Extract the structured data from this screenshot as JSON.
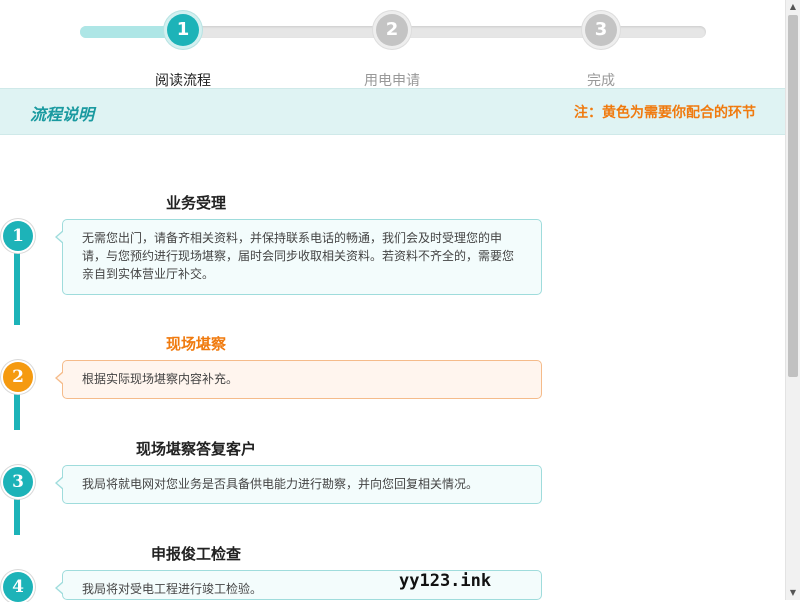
{
  "stepper": {
    "steps": [
      {
        "number": "1",
        "label": "阅读流程",
        "state": "active"
      },
      {
        "number": "2",
        "label": "用电申请",
        "state": "inactive"
      },
      {
        "number": "3",
        "label": "完成",
        "state": "inactive"
      }
    ]
  },
  "band": {
    "title": "流程说明",
    "note": "注：黄色为需要你配合的环节"
  },
  "timeline": [
    {
      "number": "1",
      "title": "业务受理",
      "highlight": false,
      "text": "无需您出门，请备齐相关资料，并保持联系电话的畅通，我们会及时受理您的申请，与您预约进行现场堪察，届时会同步收取相关资料。若资料不齐全的，需要您亲自到实体营业厅补交。"
    },
    {
      "number": "2",
      "title": "现场堪察",
      "highlight": true,
      "text": "根据实际现场堪察内容补充。"
    },
    {
      "number": "3",
      "title": "现场堪察答复客户",
      "highlight": false,
      "text": "我局将就电网对您业务是否具备供电能力进行勘察，并向您回复相关情况。"
    },
    {
      "number": "4",
      "title": "申报俊工检查",
      "highlight": false,
      "text": "我局将对受电工程进行竣工检验。"
    }
  ],
  "watermark": "yy123.ink",
  "colors": {
    "accent": "#1db3b8",
    "highlight": "#f07a0e",
    "band_bg": "#dff3f3"
  }
}
